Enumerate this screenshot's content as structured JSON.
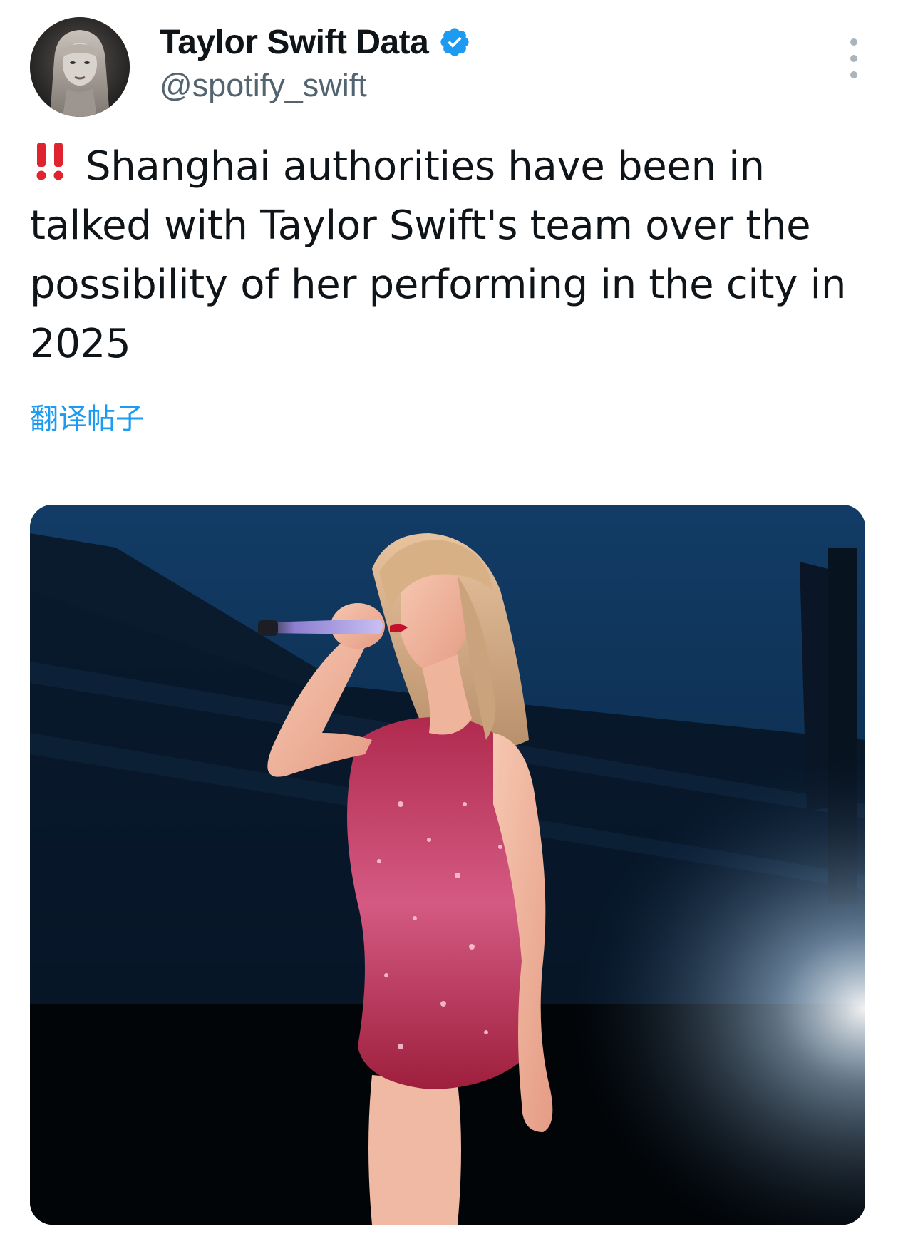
{
  "author": {
    "display_name": "Taylor Swift Data",
    "handle": "@spotify_swift",
    "verified": true,
    "avatar_icon": "avatar-photo"
  },
  "post": {
    "text": "Shanghai authorities have been in talked with Taylor Swift's team over the possibility of her performing in the city in 2025",
    "leading_emoji": "double-exclamation-icon",
    "translate_label": "翻译帖子"
  },
  "colors": {
    "verified_badge": "#1d9bf0",
    "link": "#1d9bf0",
    "emoji_red": "#e0242f"
  },
  "media": {
    "type": "photo",
    "description_icon": "concert-photo"
  }
}
